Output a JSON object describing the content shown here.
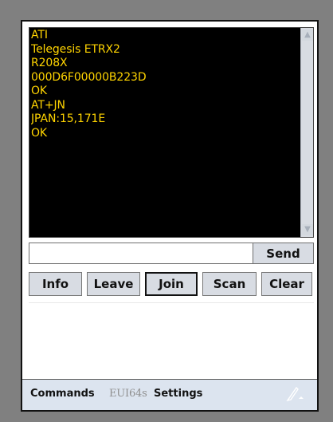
{
  "terminal": {
    "lines": [
      "ATI",
      "Telegesis ETRX2",
      "R208X",
      "000D6F00000B223D",
      "OK",
      "AT+JN",
      "JPAN:15,171E",
      "OK"
    ],
    "text_color": "#ffd400",
    "background": "#000000"
  },
  "command_input": {
    "value": "",
    "placeholder": ""
  },
  "send": {
    "label": "Send"
  },
  "actions": {
    "info": "Info",
    "leave": "Leave",
    "join": "Join",
    "scan": "Scan",
    "clear": "Clear"
  },
  "bottom_menu": {
    "commands": "Commands",
    "eui64s": "EUI64s",
    "settings": "Settings"
  },
  "icons": {
    "scroll_up": "scroll-up-arrow-icon",
    "scroll_down": "scroll-down-arrow-icon",
    "pen": "pen-input-icon"
  },
  "colors": {
    "device_frame": "#808080",
    "button_fill": "#d8dce3",
    "menu_bar": "#dce4ef",
    "disabled_menu": "#8f8f8f"
  }
}
